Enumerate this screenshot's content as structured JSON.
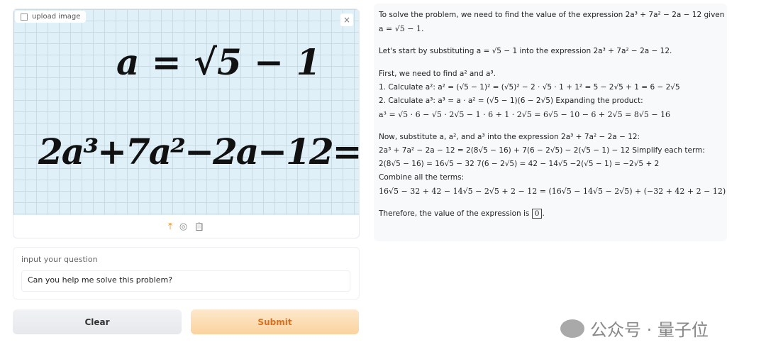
{
  "image_upload": {
    "label": "upload image",
    "close_icon": "×",
    "equation_line1": "a = √5 − 1",
    "equation_line2": "2a³+7a²−2a−12=",
    "question_mark": "?",
    "question_mark_color": "#c0272d",
    "tools": {
      "upload_icon": "⤒",
      "webcam_icon": "◎",
      "clipboard_icon": "📋"
    }
  },
  "question": {
    "label": "input your question",
    "value": "Can you help me solve this problem?"
  },
  "buttons": {
    "clear": "Clear",
    "submit": "Submit"
  },
  "accent_color": "#f6a94a",
  "answer": {
    "lines": [
      "To solve the problem, we need to find the value of the expression 2a³ + 7a² − 2a − 12 given that",
      "a = √5 − 1.",
      "Let's start by substituting a = √5 − 1 into the expression 2a³ + 7a² − 2a − 12.",
      "First, we need to find a² and a³.",
      "1. Calculate a²: a² = (√5 − 1)² = (√5)² − 2 · √5 · 1 + 1² = 5 − 2√5 + 1 = 6 − 2√5",
      "2. Calculate a³: a³ = a · a² = (√5 − 1)(6 − 2√5) Expanding the product:",
      "a³ = √5 · 6 − √5 · 2√5 − 1 · 6 + 1 · 2√5 = 6√5 − 10 − 6 + 2√5 = 8√5 − 16",
      "Now, substitute a, a², and a³ into the expression 2a³ + 7a² − 2a − 12:",
      "2a³ + 7a² − 2a − 12 = 2(8√5 − 16) + 7(6 − 2√5) − 2(√5 − 1) − 12 Simplify each term:",
      "2(8√5 − 16) = 16√5 − 32 7(6 − 2√5) = 42 − 14√5 −2(√5 − 1) = −2√5 + 2",
      "Combine all the terms:",
      "16√5 − 32 + 42 − 14√5 − 2√5 + 2 − 12 = (16√5 − 14√5 − 2√5) + (−32 + 42 + 2 − 12) =",
      "Therefore, the value of the expression is"
    ],
    "final_value": "0",
    "final_punct": "."
  },
  "watermark": "公众号 · 量子位"
}
